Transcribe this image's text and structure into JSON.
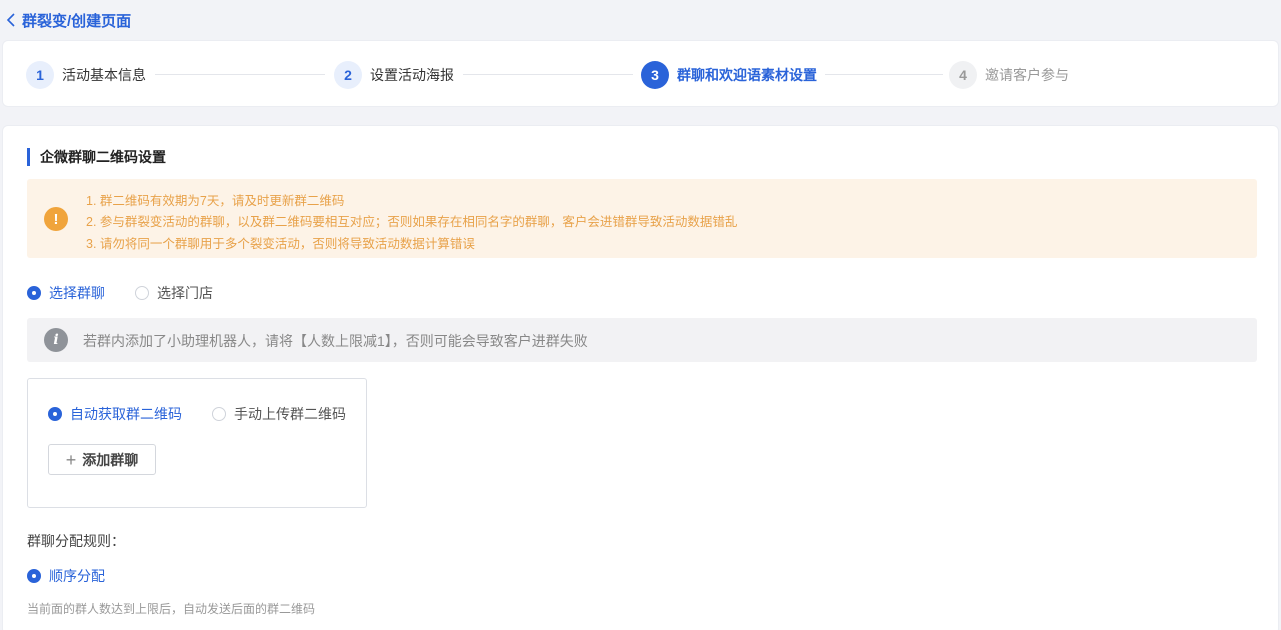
{
  "header": {
    "title": "群裂变/创建页面"
  },
  "steps": [
    {
      "num": "1",
      "label": "活动基本信息",
      "state": "done"
    },
    {
      "num": "2",
      "label": "设置活动海报",
      "state": "done"
    },
    {
      "num": "3",
      "label": "群聊和欢迎语素材设置",
      "state": "active"
    },
    {
      "num": "4",
      "label": "邀请客户参与",
      "state": "pending"
    }
  ],
  "section": {
    "title": "企微群聊二维码设置"
  },
  "warning": {
    "icon": "exclamation-icon",
    "color": "#e8a24a",
    "lines": [
      "1. 群二维码有效期为7天，请及时更新群二维码",
      "2. 参与群裂变活动的群聊，以及群二维码要相互对应；否则如果存在相同名字的群聊，客户会进错群导致活动数据错乱",
      "3. 请勿将同一个群聊用于多个裂变活动，否则将导致活动数据计算错误"
    ]
  },
  "source_radio": {
    "options": [
      {
        "label": "选择群聊",
        "checked": true
      },
      {
        "label": "选择门店",
        "checked": false
      }
    ]
  },
  "info": {
    "icon": "info-icon",
    "text": "若群内添加了小助理机器人，请将【人数上限减1】，否则可能会导致客户进群失败"
  },
  "qr_mode": {
    "options": [
      {
        "label": "自动获取群二维码",
        "checked": true
      },
      {
        "label": "手动上传群二维码",
        "checked": false
      }
    ],
    "add_button": "添加群聊"
  },
  "rule": {
    "label": "群聊分配规则：",
    "option": "顺序分配",
    "description": "当前面的群人数达到上限后，自动发送后面的群二维码"
  },
  "colors": {
    "accent": "#2a63d9",
    "warning_bg": "#fdf3e7",
    "info_bg": "#f2f2f4"
  }
}
